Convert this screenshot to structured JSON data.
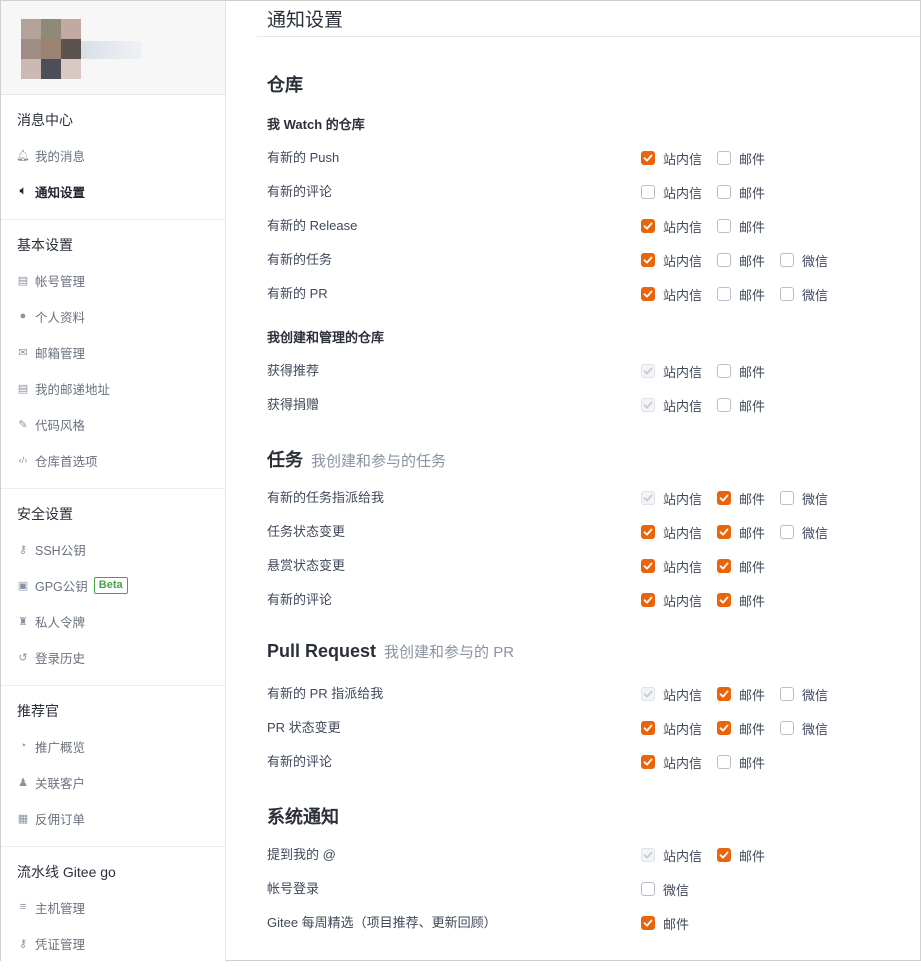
{
  "colors": {
    "accent": "#e8650b",
    "beta": "#3ea74a"
  },
  "sidebar": {
    "groups": [
      {
        "title": "消息中心",
        "items": [
          {
            "label": "我的消息",
            "icon": "bell-icon",
            "active": false
          },
          {
            "label": "通知设置",
            "icon": "volume-icon",
            "active": true
          }
        ]
      },
      {
        "title": "基本设置",
        "items": [
          {
            "label": "帐号管理",
            "icon": "id-card-icon"
          },
          {
            "label": "个人资料",
            "icon": "user-icon"
          },
          {
            "label": "邮箱管理",
            "icon": "envelope-icon"
          },
          {
            "label": "我的邮递地址",
            "icon": "address-card-icon"
          },
          {
            "label": "代码风格",
            "icon": "brush-icon"
          },
          {
            "label": "仓库首选项",
            "icon": "code-icon"
          }
        ]
      },
      {
        "title": "安全设置",
        "items": [
          {
            "label": "SSH公钥",
            "icon": "key-icon"
          },
          {
            "label": "GPG公钥",
            "icon": "lock-icon",
            "badge": "Beta"
          },
          {
            "label": "私人令牌",
            "icon": "token-icon"
          },
          {
            "label": "登录历史",
            "icon": "history-icon"
          }
        ]
      },
      {
        "title": "推荐官",
        "items": [
          {
            "label": "推广概览",
            "icon": "dashboard-icon"
          },
          {
            "label": "关联客户",
            "icon": "user-link-icon"
          },
          {
            "label": "反佣订单",
            "icon": "order-icon"
          }
        ]
      },
      {
        "title": "流水线 Gitee go",
        "items": [
          {
            "label": "主机管理",
            "icon": "server-icon"
          },
          {
            "label": "凭证管理",
            "icon": "key-icon"
          }
        ]
      }
    ]
  },
  "page": {
    "title": "通知设置"
  },
  "sections": [
    {
      "title": "仓库",
      "subtitle": ""
    },
    {
      "title": "任务",
      "subtitle": "我创建和参与的任务"
    },
    {
      "title": "Pull Request",
      "subtitle": "我创建和参与的 PR"
    },
    {
      "title": "系统通知",
      "subtitle": ""
    }
  ],
  "subheads": [
    "我 Watch 的仓库",
    "我创建和管理的仓库"
  ],
  "options": {
    "site": "站内信",
    "email": "邮件",
    "wechat": "微信"
  },
  "rows": [
    {
      "label": "有新的 Push",
      "opts": [
        [
          "site",
          "on"
        ],
        [
          "email",
          "off"
        ]
      ]
    },
    {
      "label": "有新的评论",
      "opts": [
        [
          "site",
          "off"
        ],
        [
          "email",
          "off"
        ]
      ]
    },
    {
      "label": "有新的 Release",
      "opts": [
        [
          "site",
          "on"
        ],
        [
          "email",
          "off"
        ]
      ]
    },
    {
      "label": "有新的任务",
      "opts": [
        [
          "site",
          "on"
        ],
        [
          "email",
          "off"
        ],
        [
          "wechat",
          "off"
        ]
      ]
    },
    {
      "label": "有新的 PR",
      "opts": [
        [
          "site",
          "on"
        ],
        [
          "email",
          "off"
        ],
        [
          "wechat",
          "off"
        ]
      ]
    },
    {
      "label": "获得推荐",
      "opts": [
        [
          "site",
          "dis"
        ],
        [
          "email",
          "off"
        ]
      ]
    },
    {
      "label": "获得捐赠",
      "opts": [
        [
          "site",
          "dis"
        ],
        [
          "email",
          "off"
        ]
      ]
    },
    {
      "label": "有新的任务指派给我",
      "opts": [
        [
          "site",
          "dis"
        ],
        [
          "email",
          "on"
        ],
        [
          "wechat",
          "off"
        ]
      ]
    },
    {
      "label": "任务状态变更",
      "opts": [
        [
          "site",
          "on"
        ],
        [
          "email",
          "on"
        ],
        [
          "wechat",
          "off"
        ]
      ]
    },
    {
      "label": "悬赏状态变更",
      "opts": [
        [
          "site",
          "on"
        ],
        [
          "email",
          "on"
        ]
      ]
    },
    {
      "label": "有新的评论",
      "opts": [
        [
          "site",
          "on"
        ],
        [
          "email",
          "on"
        ]
      ]
    },
    {
      "label": "有新的 PR 指派给我",
      "opts": [
        [
          "site",
          "dis"
        ],
        [
          "email",
          "on"
        ],
        [
          "wechat",
          "off"
        ]
      ]
    },
    {
      "label": "PR 状态变更",
      "opts": [
        [
          "site",
          "on"
        ],
        [
          "email",
          "on"
        ],
        [
          "wechat",
          "off"
        ]
      ]
    },
    {
      "label": "有新的评论",
      "opts": [
        [
          "site",
          "on"
        ],
        [
          "email",
          "off"
        ]
      ]
    },
    {
      "label": "提到我的 @",
      "opts": [
        [
          "site",
          "dis"
        ],
        [
          "email",
          "on"
        ]
      ]
    },
    {
      "label": "帐号登录",
      "opts": [
        [
          "wechat",
          "off"
        ]
      ]
    },
    {
      "label": "Gitee 每周精选（项目推荐、更新回顾）",
      "opts": [
        [
          "email",
          "on"
        ]
      ]
    }
  ]
}
